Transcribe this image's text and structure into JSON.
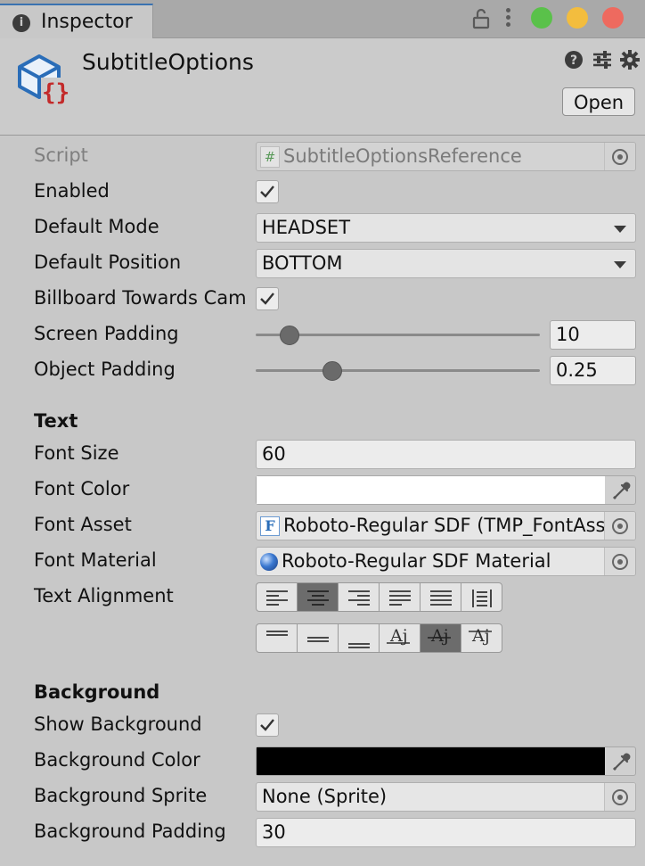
{
  "window": {
    "tab_label": "Inspector",
    "traffic_lights": {
      "green": "#5ac14a",
      "yellow": "#f3bd3e",
      "red": "#ee6a5f"
    }
  },
  "header": {
    "asset_name": "SubtitleOptions",
    "open_label": "Open",
    "icons": [
      "help-icon",
      "settings-sliders-icon",
      "gear-icon"
    ]
  },
  "fields": {
    "script": {
      "label": "Script",
      "value": "SubtitleOptionsReference"
    },
    "enabled": {
      "label": "Enabled",
      "checked": true
    },
    "default_mode": {
      "label": "Default Mode",
      "value": "HEADSET"
    },
    "default_position": {
      "label": "Default Position",
      "value": "BOTTOM"
    },
    "billboard": {
      "label": "Billboard Towards Cam",
      "checked": true
    },
    "screen_padding": {
      "label": "Screen Padding",
      "value": "10",
      "slider_fraction": 0.12
    },
    "object_padding": {
      "label": "Object Padding",
      "value": "0.25",
      "slider_fraction": 0.27
    }
  },
  "text_section": {
    "heading": "Text",
    "font_size": {
      "label": "Font Size",
      "value": "60"
    },
    "font_color": {
      "label": "Font Color",
      "color": "#ffffff"
    },
    "font_asset": {
      "label": "Font Asset",
      "value": "Roboto-Regular SDF (TMP_FontAsset)"
    },
    "font_material": {
      "label": "Font Material",
      "value": "Roboto-Regular SDF Material"
    },
    "text_alignment": {
      "label": "Text Alignment",
      "horizontal": [
        "align-left-icon",
        "align-center-icon",
        "align-right-icon",
        "justify-icon",
        "flush-icon",
        "geometry-center-icon"
      ],
      "horizontal_selected": 1,
      "vertical": [
        "align-top-icon",
        "align-middle-icon",
        "align-bottom-icon",
        "align-baseline-icon",
        "align-midline-icon",
        "align-capline-icon"
      ],
      "vertical_selected": 4,
      "glyph": "Aj"
    }
  },
  "background_section": {
    "heading": "Background",
    "show_background": {
      "label": "Show Background",
      "checked": true
    },
    "background_color": {
      "label": "Background Color",
      "color": "#000000"
    },
    "background_sprite": {
      "label": "Background Sprite",
      "value": "None (Sprite)"
    },
    "background_padding": {
      "label": "Background Padding",
      "value": "30"
    }
  }
}
